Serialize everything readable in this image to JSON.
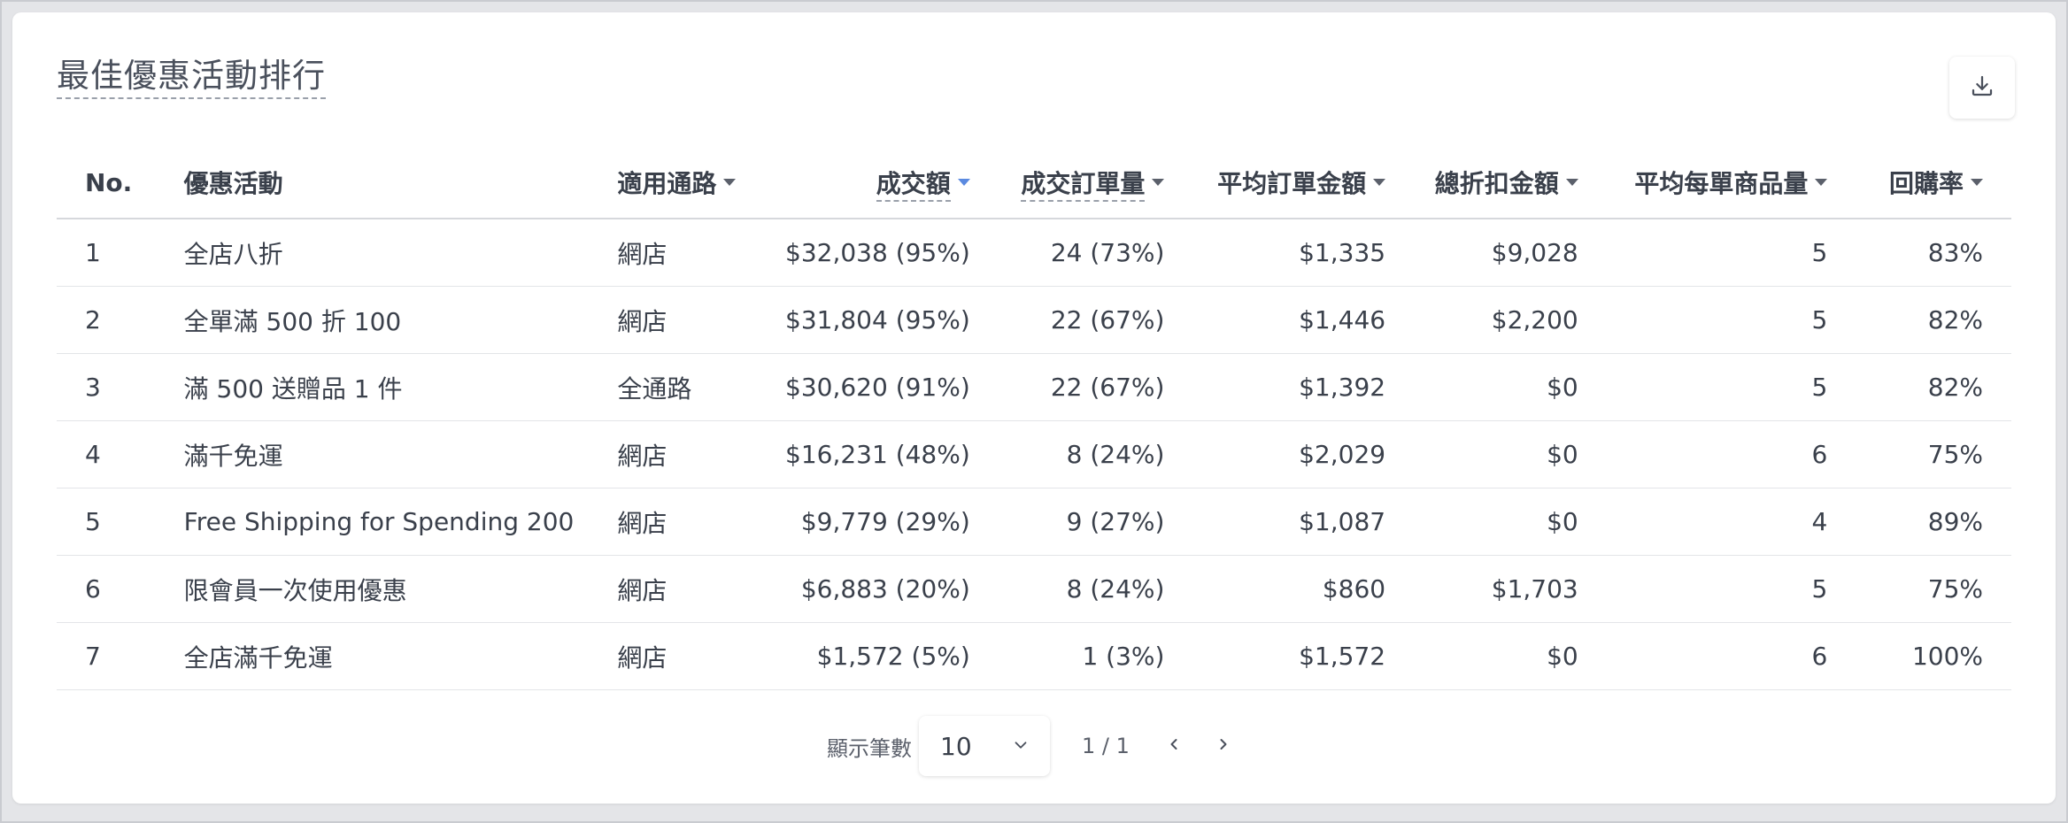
{
  "title": "最佳優惠活動排行",
  "download": {
    "icon": "download-icon"
  },
  "table": {
    "headers": {
      "no": "No.",
      "name": "優惠活動",
      "channel": "適用通路",
      "revenue": "成交額",
      "orders": "成交訂單量",
      "avg_order": "平均訂單金額",
      "discount": "總折扣金額",
      "avg_items": "平均每單商品量",
      "repurchase": "回購率"
    },
    "rows": [
      {
        "no": "1",
        "name": "全店八折",
        "channel": "網店",
        "revenue": "$32,038 (95%)",
        "orders": "24 (73%)",
        "avg_order": "$1,335",
        "discount": "$9,028",
        "avg_items": "5",
        "repurchase": "83%"
      },
      {
        "no": "2",
        "name": "全單滿 500 折 100",
        "channel": "網店",
        "revenue": "$31,804 (95%)",
        "orders": "22 (67%)",
        "avg_order": "$1,446",
        "discount": "$2,200",
        "avg_items": "5",
        "repurchase": "82%"
      },
      {
        "no": "3",
        "name": "滿 500 送贈品 1 件",
        "channel": "全通路",
        "revenue": "$30,620 (91%)",
        "orders": "22 (67%)",
        "avg_order": "$1,392",
        "discount": "$0",
        "avg_items": "5",
        "repurchase": "82%"
      },
      {
        "no": "4",
        "name": "滿千免運",
        "channel": "網店",
        "revenue": "$16,231 (48%)",
        "orders": "8 (24%)",
        "avg_order": "$2,029",
        "discount": "$0",
        "avg_items": "6",
        "repurchase": "75%"
      },
      {
        "no": "5",
        "name": "Free Shipping for Spending 200",
        "channel": "網店",
        "revenue": "$9,779 (29%)",
        "orders": "9 (27%)",
        "avg_order": "$1,087",
        "discount": "$0",
        "avg_items": "4",
        "repurchase": "89%"
      },
      {
        "no": "6",
        "name": "限會員一次使用優惠",
        "channel": "網店",
        "revenue": "$6,883 (20%)",
        "orders": "8 (24%)",
        "avg_order": "$860",
        "discount": "$1,703",
        "avg_items": "5",
        "repurchase": "75%"
      },
      {
        "no": "7",
        "name": "全店滿千免運",
        "channel": "網店",
        "revenue": "$1,572 (5%)",
        "orders": "1 (3%)",
        "avg_order": "$1,572",
        "discount": "$0",
        "avg_items": "6",
        "repurchase": "100%"
      }
    ]
  },
  "pagination": {
    "page_size_label": "顯示筆數",
    "page_size_value": "10",
    "page_info": "1 / 1"
  },
  "colors": {
    "active_sort": "#5b8ae0",
    "text": "#3a404b",
    "background": "#e4e5e8"
  }
}
